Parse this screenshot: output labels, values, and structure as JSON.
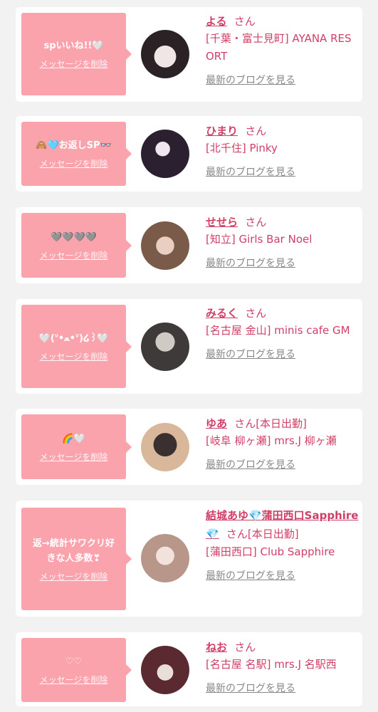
{
  "cards": [
    {
      "message": "spいいね!!🤍",
      "delete_label": "メッセージを削除",
      "name": "よる",
      "san": "さん",
      "shop": "[千葉・富士見町] AYANA RESORT",
      "blog_link": "最新のブログを見る"
    },
    {
      "message": "🙈🩵お返しSP👓",
      "delete_label": "メッセージを削除",
      "name": "ひまり",
      "san": "さん",
      "shop": "[北千住] Pinky",
      "blog_link": "最新のブログを見る"
    },
    {
      "message": "🩶🩶🩶🩶",
      "delete_label": "メッセージを削除",
      "name": "せせら",
      "san": "さん",
      "shop": "[知立] Girls Bar Noel",
      "blog_link": "最新のブログを見る"
    },
    {
      "message": "🤍(ᐡ•ﻌ•ᐡ)໒꒱🤍",
      "delete_label": "メッセージを削除",
      "name": "みるく",
      "san": "さん",
      "shop": "[名古屋 金山] minis cafe GM",
      "blog_link": "最新のブログを見る"
    },
    {
      "message": "🌈🤍",
      "delete_label": "メッセージを削除",
      "name": "ゆあ",
      "san": "さん[本日出勤]",
      "shop": "[岐阜 柳ヶ瀬] mrs.J 柳ヶ瀬",
      "blog_link": "最新のブログを見る"
    },
    {
      "message": "返→統計サワクリ好きな人多数❣",
      "delete_label": "メッセージを削除",
      "name": "結城あゆ💎蒲田西口Sapphire💎",
      "san": "さん[本日出勤]",
      "shop": "[蒲田西口] Club Sapphire",
      "blog_link": "最新のブログを見る"
    },
    {
      "message": "♡♡",
      "delete_label": "メッセージを削除",
      "name": "ねお",
      "san": "さん",
      "shop": "[名古屋 名駅] mrs.J 名駅西",
      "blog_link": "最新のブログを見る"
    }
  ],
  "colors": {
    "bubble": "#fba3ad",
    "name": "#d03f67",
    "link": "#888888",
    "background": "#f2f2f2"
  }
}
